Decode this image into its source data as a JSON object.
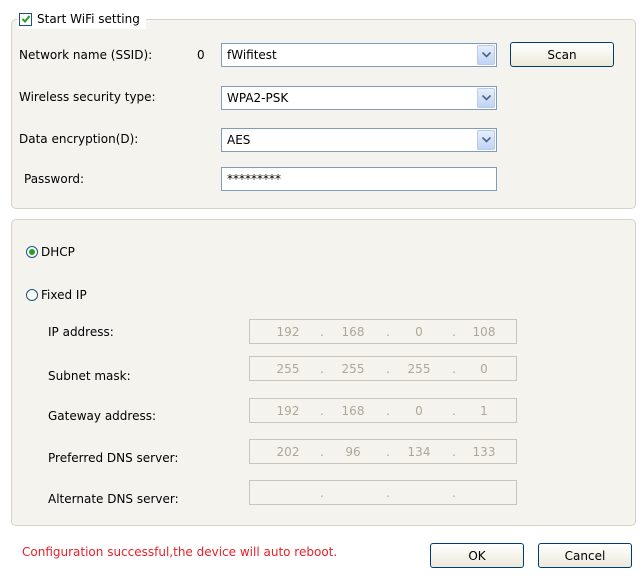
{
  "wifi": {
    "start_label": "Start WiFi setting",
    "start_checked": true,
    "ssid_label": "Network name (SSID):",
    "ssid_count": "0",
    "ssid_value": "fWifitest",
    "scan_label": "Scan",
    "security_label": "Wireless security type:",
    "security_value": "WPA2-PSK",
    "encryption_label": "Data encryption(D):",
    "encryption_value": "AES",
    "password_label": "Password:",
    "password_value": "*********"
  },
  "ip": {
    "dhcp_label": "DHCP",
    "dhcp_selected": true,
    "fixed_label": "Fixed IP",
    "fixed_selected": false,
    "ip_label": "IP address:",
    "ip_octets": [
      "192",
      "168",
      "0",
      "108"
    ],
    "mask_label": "Subnet mask:",
    "mask_octets": [
      "255",
      "255",
      "255",
      "0"
    ],
    "gateway_label": "Gateway address:",
    "gateway_octets": [
      "192",
      "168",
      "0",
      "1"
    ],
    "dns1_label": "Preferred DNS server:",
    "dns1_octets": [
      "202",
      "96",
      "134",
      "133"
    ],
    "dns2_label": "Alternate DNS server:",
    "dns2_octets": [
      "",
      "",
      "",
      ""
    ]
  },
  "footer": {
    "status": "Configuration successful,the device will auto reboot.",
    "ok_label": "OK",
    "cancel_label": "Cancel"
  },
  "colors": {
    "status_text": "#e8202a",
    "group_bg": "#f4f3ee",
    "checkmark": "#21a121",
    "disabled_text": "#aca899"
  }
}
